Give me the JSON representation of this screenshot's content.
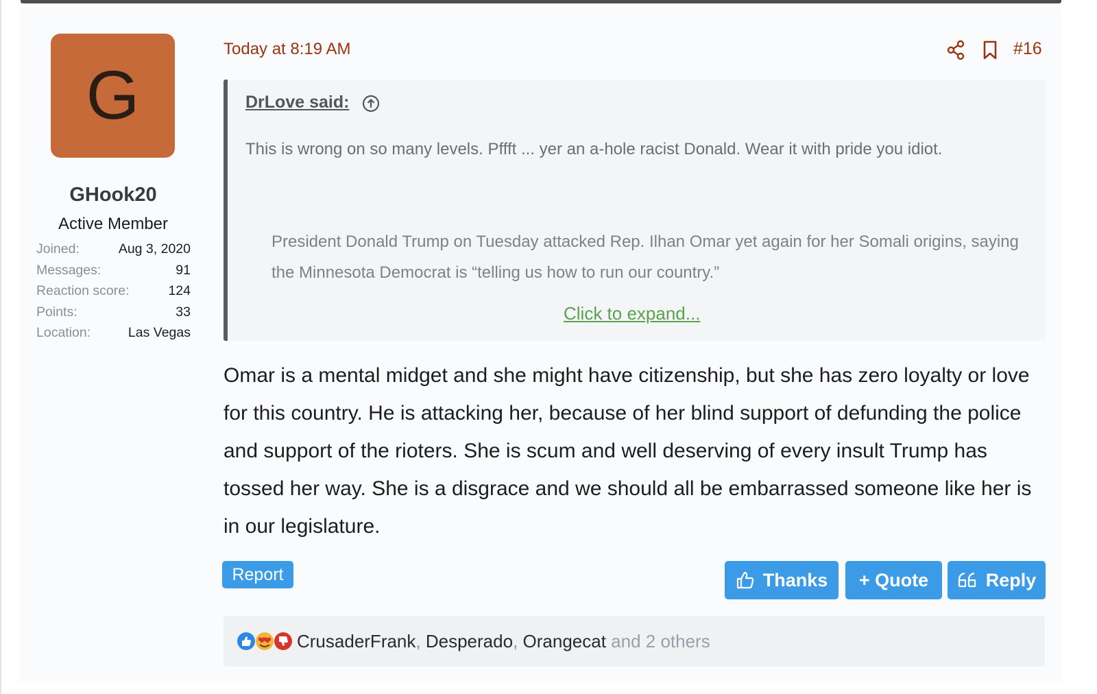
{
  "user": {
    "avatar_letter": "G",
    "username": "GHook20",
    "title": "Active Member",
    "stats": [
      {
        "label": "Joined:",
        "value": "Aug 3, 2020"
      },
      {
        "label": "Messages:",
        "value": "91"
      },
      {
        "label": "Reaction score:",
        "value": "124"
      },
      {
        "label": "Points:",
        "value": "33"
      },
      {
        "label": "Location:",
        "value": "Las Vegas"
      }
    ]
  },
  "post": {
    "timestamp": "Today at 8:19 AM",
    "number": "#16",
    "icons": [
      "share-icon",
      "bookmark-icon"
    ],
    "quote": {
      "author_label": "DrLove said:",
      "text": "This is wrong on so many levels. Pffft ... yer an a-hole racist Donald. Wear it with pride you idiot.",
      "nested_text": "President Donald Trump on Tuesday attacked Rep. Ilhan Omar yet again for her Somali origins, saying the Minnesota Democrat is “telling us how to run our country.”",
      "expand_label": "Click to expand..."
    },
    "message": "Omar is a mental midget and she might have citizenship, but she has zero loyalty or love for this country. He is attacking her, because of her blind support of defunding the police and support of the rioters. She is scum and well deserving of every insult Trump has tossed her way. She is a disgrace and we should all be embarrassed someone like her is in our legislature."
  },
  "actions": {
    "report": "Report",
    "thanks": "Thanks",
    "quote": "+ Quote",
    "reply": "Reply"
  },
  "reactions": {
    "users": [
      "CrusaderFrank",
      "Desperado",
      "Orangecat"
    ],
    "separator": ", ",
    "others": "and 2 others"
  },
  "colors": {
    "accent_button": "#3c9be6",
    "timestamp": "#9a3412",
    "avatar_bg": "#c66a3a",
    "expand_link": "#5aa150"
  }
}
